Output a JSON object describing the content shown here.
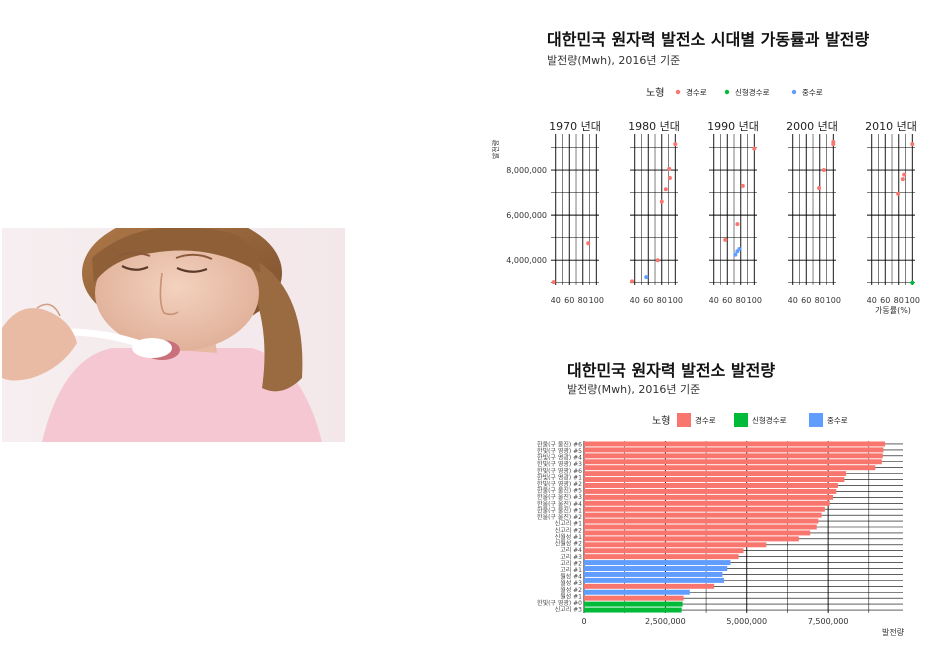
{
  "photo": {
    "description_icon": "woman-tasting-spoon-photo"
  },
  "scatter": {
    "title": "대한민국 원자력 발전소 시대별 가동률과 발전량",
    "subtitle": "발전량(Mwh), 2016년 기준",
    "legend_title": "노형",
    "xlabel": "가동률(%)",
    "ylabel": "발전량"
  },
  "bar": {
    "title": "대한민국 원자력 발전소 발전량",
    "subtitle": "발전량(Mwh), 2016년 기준",
    "legend_title": "노형",
    "xlabel": "발전량"
  },
  "chart_data": [
    {
      "type": "scatter",
      "facets": [
        "1970 년대",
        "1980 년대",
        "1990 년대",
        "2000 년대",
        "2010 년대"
      ],
      "x_ticks": [
        40,
        60,
        80,
        100
      ],
      "xlim": [
        33,
        104
      ],
      "y_ticks": [
        4000000,
        6000000,
        8000000
      ],
      "y_tick_labels": [
        "4,000,000",
        "6,000,000",
        "8,000,000"
      ],
      "ylim": [
        2900000,
        9600000
      ],
      "legend_position": "top",
      "colors": {
        "경수로": "#f8766d",
        "신형경수로": "#00ba38",
        "중수로": "#619cff"
      },
      "series": [
        {
          "name": "경수로",
          "points": [
            {
              "facet": "1970 년대",
              "x": 88,
              "y": 4750000
            },
            {
              "facet": "1970 년대",
              "x": 37,
              "y": 3030000
            },
            {
              "facet": "1980 년대",
              "x": 100,
              "y": 9150000
            },
            {
              "facet": "1980 년대",
              "x": 91,
              "y": 8050000
            },
            {
              "facet": "1980 년대",
              "x": 92,
              "y": 7650000
            },
            {
              "facet": "1980 년대",
              "x": 86,
              "y": 7150000
            },
            {
              "facet": "1980 년대",
              "x": 80,
              "y": 6600000
            },
            {
              "facet": "1980 년대",
              "x": 74,
              "y": 4000000
            },
            {
              "facet": "1980 년대",
              "x": 36,
              "y": 3060000
            },
            {
              "facet": "1990 년대",
              "x": 100,
              "y": 8950000
            },
            {
              "facet": "1990 년대",
              "x": 83,
              "y": 7300000
            },
            {
              "facet": "1990 년대",
              "x": 75,
              "y": 5600000
            },
            {
              "facet": "1990 년대",
              "x": 57,
              "y": 4900000
            },
            {
              "facet": "2000 년대",
              "x": 100,
              "y": 9250000
            },
            {
              "facet": "2000 년대",
              "x": 100,
              "y": 9150000
            },
            {
              "facet": "2000 년대",
              "x": 86,
              "y": 8000000
            },
            {
              "facet": "2000 년대",
              "x": 79,
              "y": 7200000
            },
            {
              "facet": "2010 년대",
              "x": 100,
              "y": 9150000
            },
            {
              "facet": "2010 년대",
              "x": 88,
              "y": 7800000
            },
            {
              "facet": "2010 년대",
              "x": 86,
              "y": 7600000
            },
            {
              "facet": "2010 년대",
              "x": 79,
              "y": 6950000
            }
          ]
        },
        {
          "name": "신형경수로",
          "points": [
            {
              "facet": "2010 년대",
              "x": 100,
              "y": 3000000
            }
          ]
        },
        {
          "name": "중수로",
          "points": [
            {
              "facet": "1980 년대",
              "x": 57,
              "y": 3250000
            },
            {
              "facet": "1990 년대",
              "x": 78,
              "y": 4500000
            },
            {
              "facet": "1990 년대",
              "x": 75,
              "y": 4400000
            },
            {
              "facet": "1990 년대",
              "x": 72,
              "y": 4250000
            }
          ]
        }
      ]
    },
    {
      "type": "bar",
      "orientation": "horizontal",
      "x_ticks": [
        0,
        2500000,
        5000000,
        7500000
      ],
      "x_tick_labels": [
        "0",
        "2,500,000",
        "5,000,000",
        "7,500,000"
      ],
      "xlim": [
        0,
        9800000
      ],
      "legend_position": "top",
      "colors": {
        "경수로": "#f8766d",
        "신형경수로": "#00ba38",
        "중수로": "#619cff"
      },
      "category_labels": [
        "한울(구 울진) #6",
        "한빛(구 영광) #5",
        "한빛(구 영광) #4",
        "한빛(구 영광) #3",
        "한빛(구 영광) #6",
        "한빛(구 영광) #1",
        "한빛(구 영광) #2",
        "한울(구 울진) #5",
        "한울(구 울진) #3",
        "한울(구 울진) #4",
        "한울(구 울진) #1",
        "한울(구 울진) #2",
        "신고리 #1",
        "신고리 #2",
        "신월성 #1",
        "신월성 #2",
        "고리 #4",
        "고리 #3",
        "고리 #2",
        "고리 #1",
        "월성 #4",
        "월성 #3",
        "월성 #2",
        "월성 #1",
        "한빛(구 영광) #0",
        "신고리 #3"
      ],
      "bars": [
        {
          "series": "경수로",
          "value": 9250000
        },
        {
          "series": "경수로",
          "value": 9200000
        },
        {
          "series": "경수로",
          "value": 9180000
        },
        {
          "series": "경수로",
          "value": 9150000
        },
        {
          "series": "경수로",
          "value": 8950000
        },
        {
          "series": "경수로",
          "value": 8050000
        },
        {
          "series": "경수로",
          "value": 8000000
        },
        {
          "series": "경수로",
          "value": 7800000
        },
        {
          "series": "경수로",
          "value": 7750000
        },
        {
          "series": "경수로",
          "value": 7650000
        },
        {
          "series": "경수로",
          "value": 7550000
        },
        {
          "series": "경수로",
          "value": 7400000
        },
        {
          "series": "경수로",
          "value": 7300000
        },
        {
          "series": "경수로",
          "value": 7200000
        },
        {
          "series": "경수로",
          "value": 7150000
        },
        {
          "series": "경수로",
          "value": 6950000
        },
        {
          "series": "경수로",
          "value": 6600000
        },
        {
          "series": "경수로",
          "value": 5600000
        },
        {
          "series": "경수로",
          "value": 4900000
        },
        {
          "series": "경수로",
          "value": 4750000
        },
        {
          "series": "중수로",
          "value": 4500000
        },
        {
          "series": "중수로",
          "value": 4400000
        },
        {
          "series": "중수로",
          "value": 4250000
        },
        {
          "series": "중수로",
          "value": 4300000
        },
        {
          "series": "경수로",
          "value": 4000000
        },
        {
          "series": "중수로",
          "value": 3250000
        },
        {
          "series": "경수로",
          "value": 3060000
        },
        {
          "series": "신형경수로",
          "value": 3030000
        },
        {
          "series": "신형경수로",
          "value": 3000000
        }
      ]
    }
  ]
}
